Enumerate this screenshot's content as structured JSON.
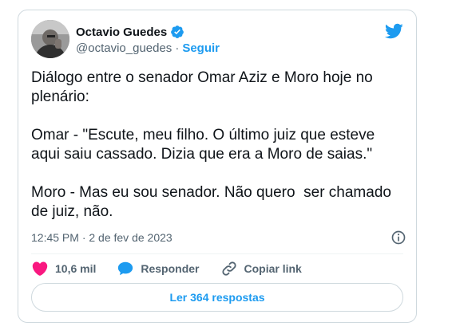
{
  "tweet": {
    "author_name": "Octavio Guedes",
    "author_handle": "@octavio_guedes",
    "separator": "·",
    "follow_label": "Seguir",
    "text": "Diálogo entre o senador Omar Aziz e Moro hoje no plenário:\n\nOmar - \"Escute, meu filho. O último juiz que esteve aqui saiu cassado. Dizia que era a Moro de saias.\"\n\nMoro - Mas eu sou senador. Não quero  ser chamado de juiz, não.",
    "timestamp": "12:45 PM · 2 de fev de 2023",
    "likes_label": "10,6 mil",
    "reply_label": "Responder",
    "copy_link_label": "Copiar link",
    "read_replies_label": "Ler 364 respostas"
  },
  "colors": {
    "accent": "#1d9bf0",
    "like": "#f91880",
    "text": "#0f1419",
    "muted": "#536471",
    "border": "#cfd9de"
  },
  "icons": {
    "brand": "twitter-bird-icon",
    "verified": "verified-badge-icon",
    "info": "info-icon",
    "like": "heart-icon",
    "reply": "speech-bubble-icon",
    "copy_link": "link-icon"
  }
}
